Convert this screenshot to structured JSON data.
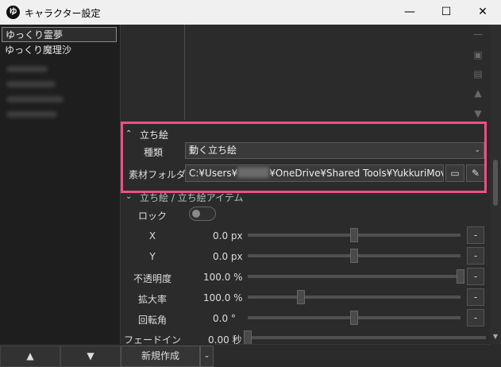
{
  "window": {
    "title": "キャラクター設定",
    "app_icon": "ゆ",
    "min": "—",
    "max": "☐",
    "close": "✕"
  },
  "characters": [
    {
      "label": "ゆっくり霊夢",
      "selected": true
    },
    {
      "label": "ゆっくり魔理沙",
      "selected": false
    }
  ],
  "list_nav": {
    "up": "▲",
    "down": "▼"
  },
  "toolbar_icons": [
    "minus-icon",
    "copy-icon",
    "save-icon",
    "move-up-icon",
    "move-down-icon"
  ],
  "tachie": {
    "section_title": "立ち絵",
    "kind_label": "種類",
    "kind_value": "動く立ち絵",
    "folder_label": "素材フォルダ",
    "folder_path_prefix": "C:¥Users¥",
    "folder_path_suffix": "¥OneDrive¥Shared Tools¥YukkuriMovieMake"
  },
  "item_section": {
    "title": "立ち絵 / 立ち絵アイテム"
  },
  "props": [
    {
      "label": "ロック"
    },
    {
      "label": "X",
      "value": "0.0 px",
      "slider": 0.5
    },
    {
      "label": "Y",
      "value": "0.0 px",
      "slider": 0.5
    },
    {
      "label": "不透明度",
      "value": "100.0 %",
      "slider": 1.0
    },
    {
      "label": "拡大率",
      "value": "100.0 %",
      "slider": 0.25
    },
    {
      "label": "回転角",
      "value": "0.0 °",
      "slider": 0.5
    },
    {
      "label": "フェードイン",
      "value": "0.00 秒",
      "slider": 0.0
    }
  ],
  "dash_label": "-",
  "new_button": "新規作成",
  "new_dropdown": "⌄",
  "colors": {
    "highlight": "#ef4f86",
    "background": "#2b2b2b"
  }
}
